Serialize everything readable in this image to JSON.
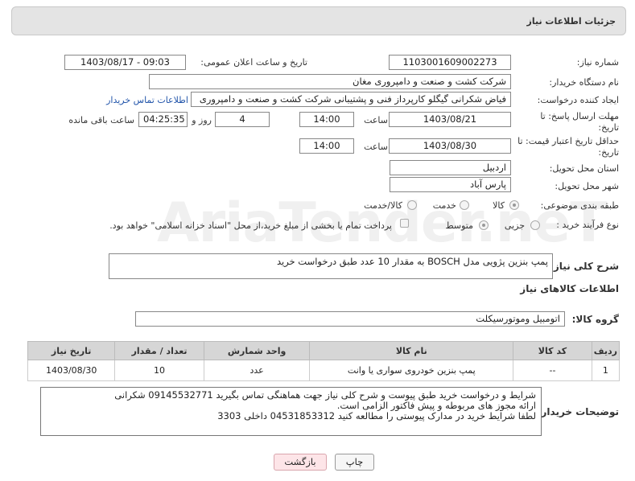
{
  "header": {
    "title": "جزئیات اطلاعات نیاز"
  },
  "need_number": {
    "label": "شماره نیاز:",
    "value": "1103001609002273"
  },
  "announce_datetime": {
    "label": "تاریخ و ساعت اعلان عمومی:",
    "value": "1403/08/17 - 09:03"
  },
  "buyer_org": {
    "label": "نام دستگاه خریدار:",
    "value": "شرکت کشت و صنعت و دامپروری مغان"
  },
  "requester": {
    "label": "ایجاد کننده درخواست:",
    "value": "فیاض شکرانی گیگلو کارپرداز فنی و پشتیبانی شرکت کشت و صنعت و دامپروری",
    "contact_link": "اطلاعات تماس خریدار"
  },
  "response_deadline": {
    "label": "مهلت ارسال پاسخ: تا تاریخ:",
    "date": "1403/08/21",
    "time_label": "ساعت",
    "time": "14:00",
    "days": "4",
    "days_label": "روز و",
    "remaining": "04:25:35",
    "remaining_label": "ساعت باقی مانده"
  },
  "price_validity": {
    "label": "حداقل تاریخ اعتبار قیمت: تا تاریخ:",
    "date": "1403/08/30",
    "time_label": "ساعت",
    "time": "14:00"
  },
  "province": {
    "label": "استان محل تحویل:",
    "value": "اردبیل"
  },
  "city": {
    "label": "شهر محل تحویل:",
    "value": "پارس آباد"
  },
  "category": {
    "label": "طبقه بندی موضوعی:",
    "options": [
      "کالا",
      "خدمت",
      "کالا/خدمت"
    ]
  },
  "purchase_type": {
    "label": "نوع فرآیند خرید :",
    "options": [
      "جزیی",
      "متوسط"
    ],
    "payment_note": "پرداخت تمام یا بخشی از مبلغ خرید،از محل \"اسناد خزانه اسلامی\" خواهد بود."
  },
  "general_desc": {
    "label": "شرح کلی نیاز:",
    "value": "پمپ بنزین پژویی مدل  BOSCH به مقدار 10 عدد طبق درخواست خرید"
  },
  "goods_info": {
    "heading": "اطلاعات کالاهای نیاز"
  },
  "goods_group": {
    "label": "گروه کالا:",
    "value": "اتومبیل وموتورسیکلت"
  },
  "table": {
    "headers": [
      "ردیف",
      "کد کالا",
      "نام کالا",
      "واحد شمارش",
      "تعداد / مقدار",
      "تاریخ نیاز"
    ],
    "rows": [
      {
        "row": "1",
        "code": "--",
        "name": "پمپ بنزین خودروی سواری یا وانت",
        "unit": "عدد",
        "qty": "10",
        "date": "1403/08/30"
      }
    ]
  },
  "buyer_notes": {
    "label": "توضیحات خریدار:",
    "value": "شرایط و درخواست خرید طبق پیوست و شرح کلی نیاز  جهت هماهنگی تماس بگیرید 09145532771 شکرانی\nارائه مجوز های مربوطه و پیش فاکتور الزامی است.\nلطفا شرایط خرید در مدارک پیوستی را مطالعه کنید  04531853312   داخلی  3303"
  },
  "buttons": {
    "print": "چاپ",
    "back": "بازگشت"
  },
  "watermark": "AriaTender.neT"
}
